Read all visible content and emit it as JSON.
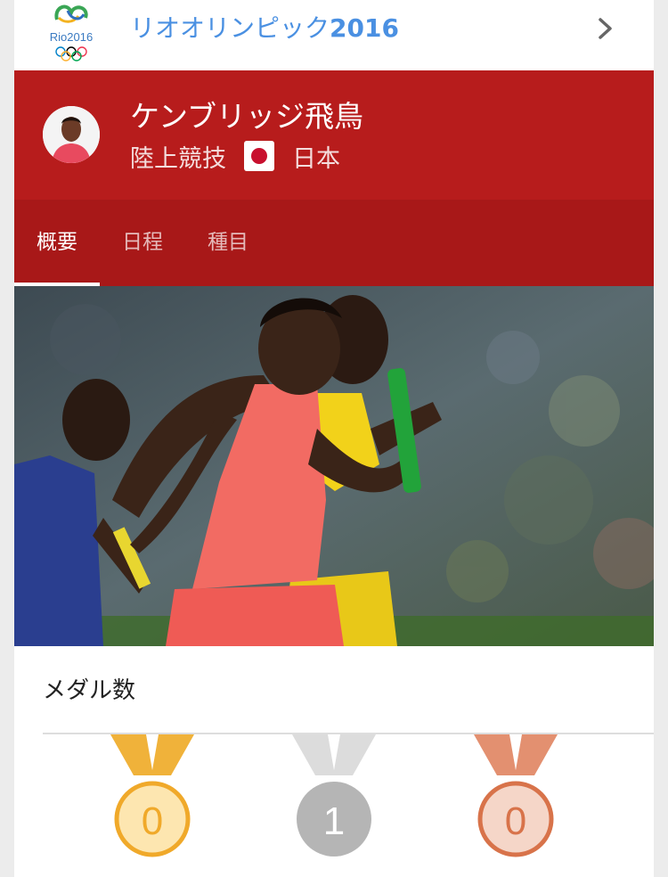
{
  "header": {
    "title_prefix": "リオオリンピック",
    "title_year": "2016",
    "logo_text": "Rio2016",
    "logo_icon": "rio2016-logo",
    "chevron_icon": "chevron-right-icon"
  },
  "athlete": {
    "name": "ケンブリッジ飛鳥",
    "sport": "陸上競技",
    "country": "日本",
    "flag_icon": "japan-flag-icon"
  },
  "tabs": [
    {
      "label": "概要",
      "active": true
    },
    {
      "label": "日程",
      "active": false
    },
    {
      "label": "種目",
      "active": false
    }
  ],
  "medals": {
    "title": "メダル数",
    "gold": "0",
    "silver": "1",
    "bronze": "0"
  },
  "colors": {
    "brand_red": "#b71c1c",
    "tab_red": "#a81818",
    "link_blue": "#4a90e2",
    "gold": "#f0b23a",
    "silver": "#b5b5b5",
    "bronze": "#d8734a"
  }
}
